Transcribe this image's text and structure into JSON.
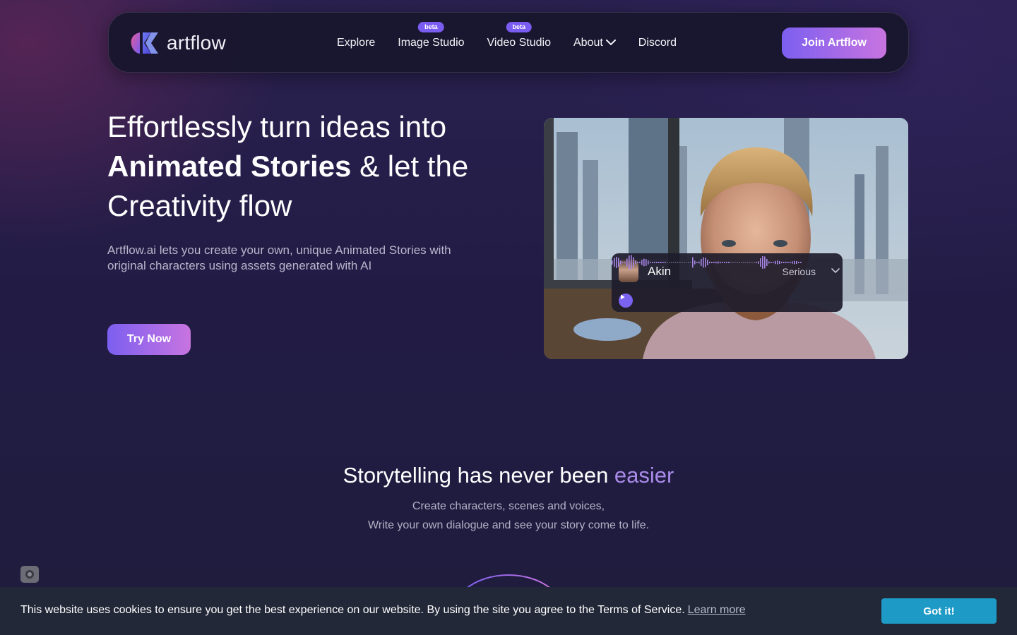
{
  "nav": {
    "logo_text": "artflow",
    "links": [
      {
        "label": "Explore",
        "badge": ""
      },
      {
        "label": "Image Studio",
        "badge": "beta"
      },
      {
        "label": "Video Studio",
        "badge": "beta"
      },
      {
        "label": "About",
        "badge": ""
      },
      {
        "label": "Discord",
        "badge": ""
      }
    ],
    "join_label": "Join Artflow"
  },
  "hero": {
    "title_line1": "Effortlessly turn ideas into",
    "title_bold": "Animated Stories",
    "title_mid": " & let the",
    "title_line3": "Creativity flow",
    "description": "Artflow.ai lets you create your own, unique Animated Stories with original characters using assets generated with AI",
    "cta_label": "Try Now"
  },
  "voice_card": {
    "name": "Akin",
    "mood": "Serious"
  },
  "section": {
    "title_main": "Storytelling has never been ",
    "title_accent": "easier",
    "sub_line1": "Create characters, scenes and voices,",
    "sub_line2": "Write your own dialogue and see your story come to life."
  },
  "cookie": {
    "text": "This website uses cookies to ensure you get the best experience on our website. By using the site you agree to the Terms of Service.",
    "link_label": "Learn more",
    "button_label": "Got it!"
  },
  "colors": {
    "accent_purple": "#7c5ff0",
    "accent_pink": "#c874e0",
    "cookie_button": "#1d9ac6"
  }
}
